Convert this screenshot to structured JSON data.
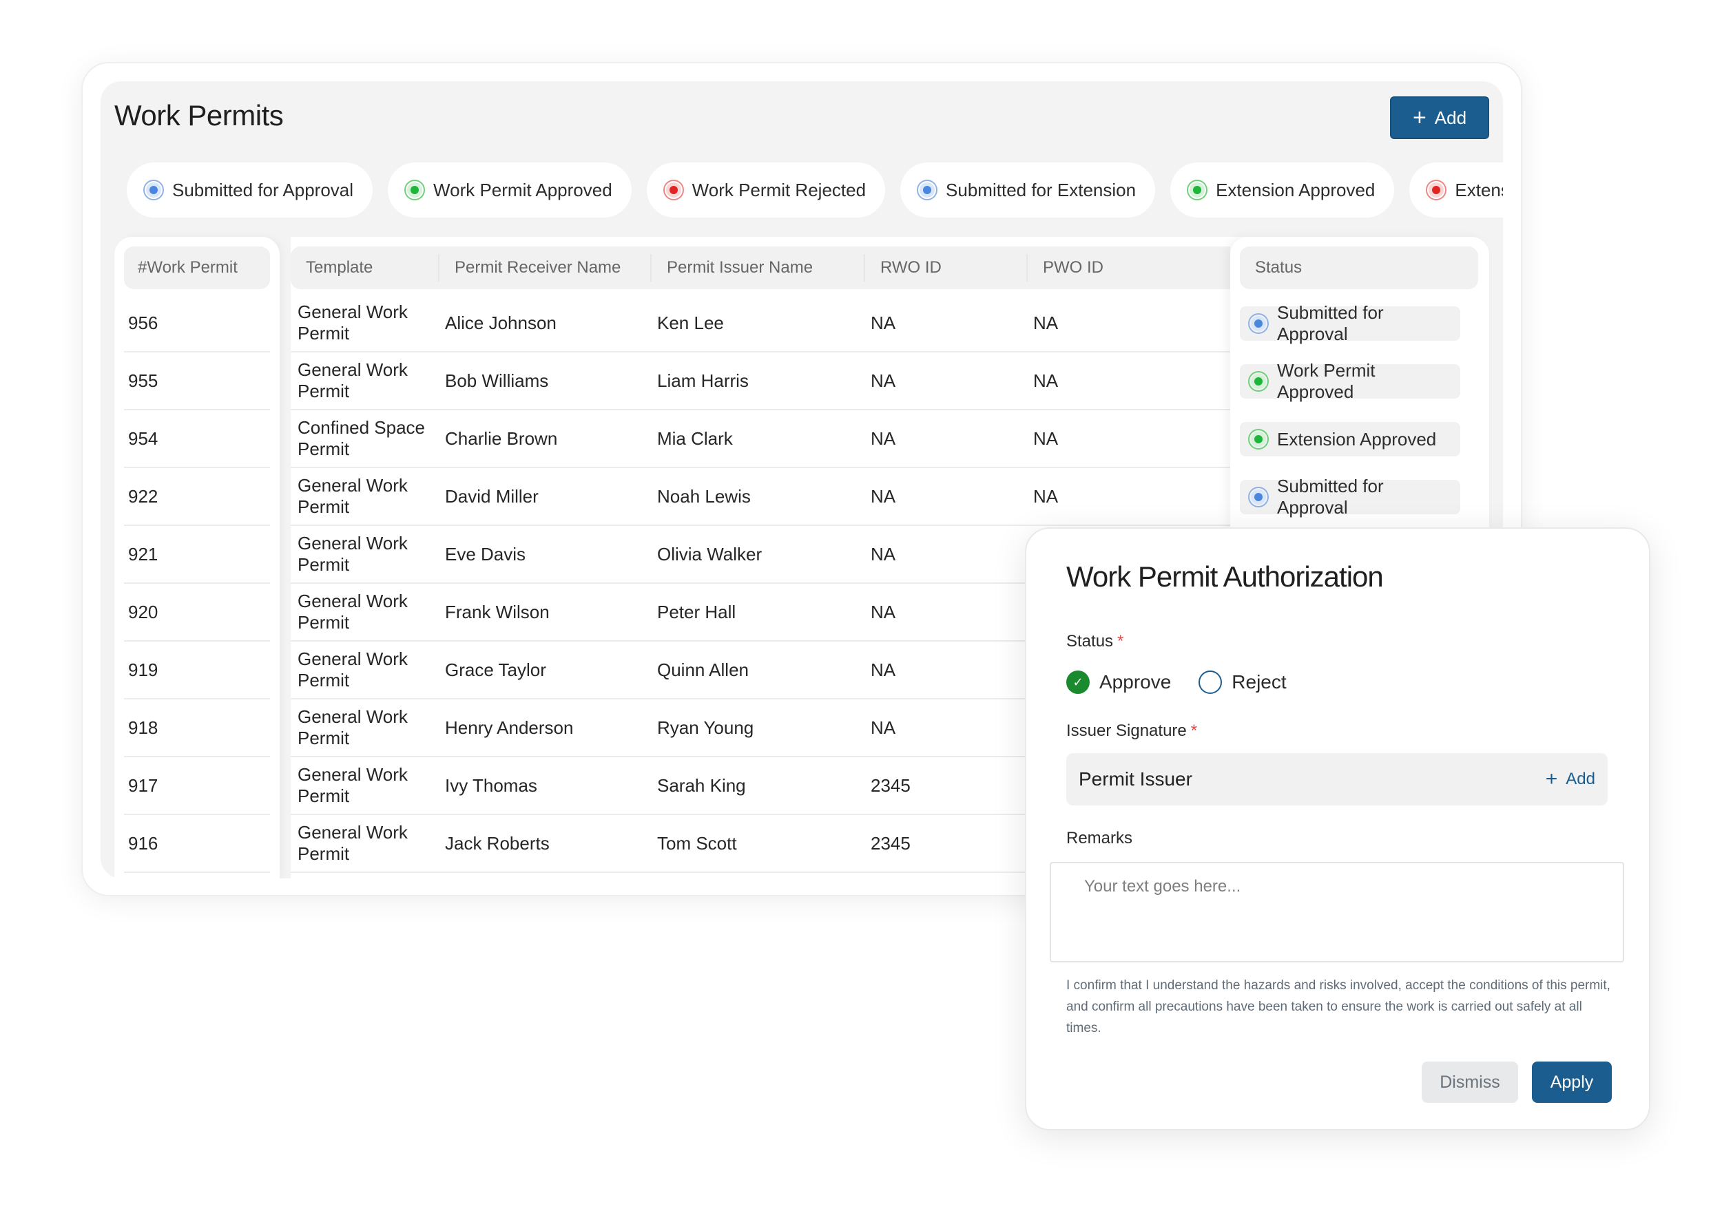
{
  "page": {
    "title": "Work Permits",
    "add_label": "Add"
  },
  "filters": [
    {
      "label": "Submitted for Approval",
      "color": "blue"
    },
    {
      "label": "Work Permit Approved",
      "color": "green"
    },
    {
      "label": "Work Permit Rejected",
      "color": "red"
    },
    {
      "label": "Submitted for Extension",
      "color": "blue"
    },
    {
      "label": "Extension Approved",
      "color": "green"
    },
    {
      "label": "Extension",
      "color": "red"
    }
  ],
  "table": {
    "headers": {
      "permit": "#Work Permit",
      "template": "Template",
      "receiver": "Permit Receiver Name",
      "issuer": "Permit Issuer Name",
      "rwo": "RWO ID",
      "pwo": "PWO ID",
      "status": "Status"
    },
    "rows": [
      {
        "id": "956",
        "template": "General Work Permit",
        "receiver": "Alice Johnson",
        "issuer": "Ken Lee",
        "rwo": "NA",
        "pwo": "NA"
      },
      {
        "id": "955",
        "template": "General Work Permit",
        "receiver": "Bob Williams",
        "issuer": "Liam Harris",
        "rwo": "NA",
        "pwo": "NA"
      },
      {
        "id": "954",
        "template": "Confined Space Permit",
        "receiver": "Charlie Brown",
        "issuer": "Mia Clark",
        "rwo": "NA",
        "pwo": "NA"
      },
      {
        "id": "922",
        "template": "General Work Permit",
        "receiver": "David Miller",
        "issuer": "Noah Lewis",
        "rwo": "NA",
        "pwo": "NA"
      },
      {
        "id": "921",
        "template": "General Work Permit",
        "receiver": "Eve Davis",
        "issuer": "Olivia Walker",
        "rwo": "NA",
        "pwo": ""
      },
      {
        "id": "920",
        "template": "General Work Permit",
        "receiver": "Frank Wilson",
        "issuer": "Peter Hall",
        "rwo": "NA",
        "pwo": ""
      },
      {
        "id": "919",
        "template": "General Work Permit",
        "receiver": "Grace Taylor",
        "issuer": "Quinn Allen",
        "rwo": "NA",
        "pwo": ""
      },
      {
        "id": "918",
        "template": "General Work Permit",
        "receiver": "Henry Anderson",
        "issuer": "Ryan Young",
        "rwo": "NA",
        "pwo": ""
      },
      {
        "id": "917",
        "template": "General Work Permit",
        "receiver": "Ivy Thomas",
        "issuer": "Sarah King",
        "rwo": "2345",
        "pwo": ""
      },
      {
        "id": "916",
        "template": "General Work Permit",
        "receiver": "Jack Roberts",
        "issuer": "Tom Scott",
        "rwo": "2345",
        "pwo": ""
      }
    ],
    "statuses": [
      {
        "label": "Submitted for Approval",
        "color": "blue"
      },
      {
        "label": "Work Permit Approved",
        "color": "green"
      },
      {
        "label": "Extension Approved",
        "color": "green"
      },
      {
        "label": "Submitted for Approval",
        "color": "blue"
      }
    ]
  },
  "modal": {
    "title": "Work Permit Authorization",
    "status_label": "Status",
    "required_mark": "*",
    "approve_label": "Approve",
    "reject_label": "Reject",
    "signature_label": "Issuer Signature",
    "signature_value": "Permit Issuer",
    "signature_add": "Add",
    "remarks_label": "Remarks",
    "remarks_placeholder": "Your text goes here...",
    "disclaimer": "I confirm that I understand the hazards and risks involved, accept the conditions of this permit, and confirm all precautions have been taken to ensure the work is carried out safely at all times.",
    "dismiss_label": "Dismiss",
    "apply_label": "Apply"
  }
}
